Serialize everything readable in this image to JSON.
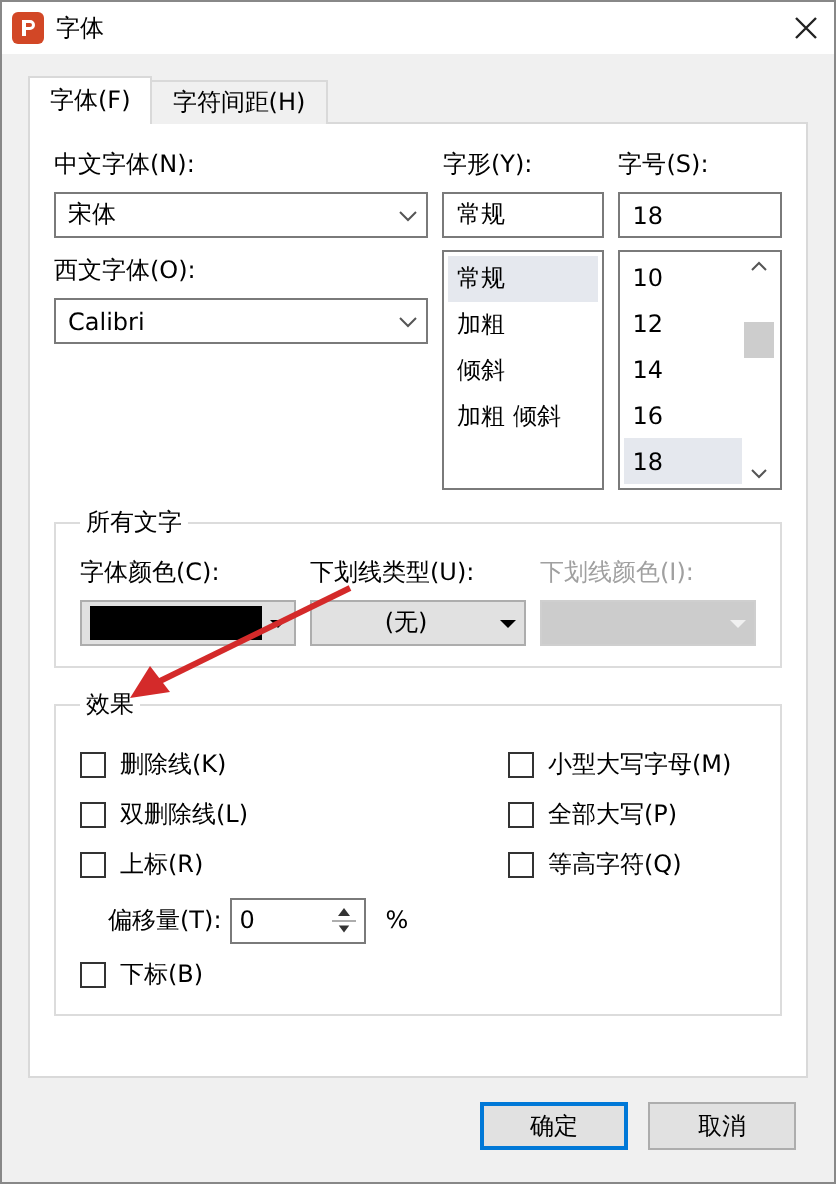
{
  "window": {
    "title": "字体"
  },
  "tabs": [
    {
      "label": "字体(F)",
      "selected": true
    },
    {
      "label": "字符间距(H)",
      "selected": false
    }
  ],
  "chinese_font": {
    "label": "中文字体(N):",
    "value": "宋体"
  },
  "western_font": {
    "label": "西文字体(O):",
    "value": "Calibri"
  },
  "style": {
    "label": "字形(Y):",
    "value": "常规",
    "options": [
      {
        "label": "常规",
        "selected": true
      },
      {
        "label": "加粗",
        "selected": false
      },
      {
        "label": "倾斜",
        "selected": false
      },
      {
        "label": "加粗 倾斜",
        "selected": false
      }
    ]
  },
  "size": {
    "label": "字号(S):",
    "value": "18",
    "options": [
      {
        "label": "10",
        "selected": false
      },
      {
        "label": "12",
        "selected": false
      },
      {
        "label": "14",
        "selected": false
      },
      {
        "label": "16",
        "selected": false
      },
      {
        "label": "18",
        "selected": true
      }
    ]
  },
  "all_text": {
    "title": "所有文字",
    "font_color": {
      "label": "字体颜色(C):",
      "color": "#000000"
    },
    "underline_type": {
      "label": "下划线类型(U):",
      "value": "(无)",
      "disabled": false
    },
    "underline_color": {
      "label": "下划线颜色(I):",
      "disabled": true
    }
  },
  "effects": {
    "title": "效果",
    "left": [
      {
        "kind": "checkbox",
        "label": "删除线(K)",
        "checked": false
      },
      {
        "kind": "checkbox",
        "label": "双删除线(L)",
        "checked": false
      },
      {
        "kind": "checkbox",
        "label": "上标(R)",
        "checked": false
      },
      {
        "kind": "offset",
        "label": "偏移量(T):",
        "value": "0",
        "unit": "%"
      },
      {
        "kind": "checkbox",
        "label": "下标(B)",
        "checked": false
      }
    ],
    "right": [
      {
        "kind": "checkbox",
        "label": "小型大写字母(M)",
        "checked": false
      },
      {
        "kind": "checkbox",
        "label": "全部大写(P)",
        "checked": false
      },
      {
        "kind": "checkbox",
        "label": "等高字符(Q)",
        "checked": false
      }
    ]
  },
  "buttons": [
    {
      "label": "确定",
      "default": true
    },
    {
      "label": "取消",
      "default": false
    }
  ]
}
